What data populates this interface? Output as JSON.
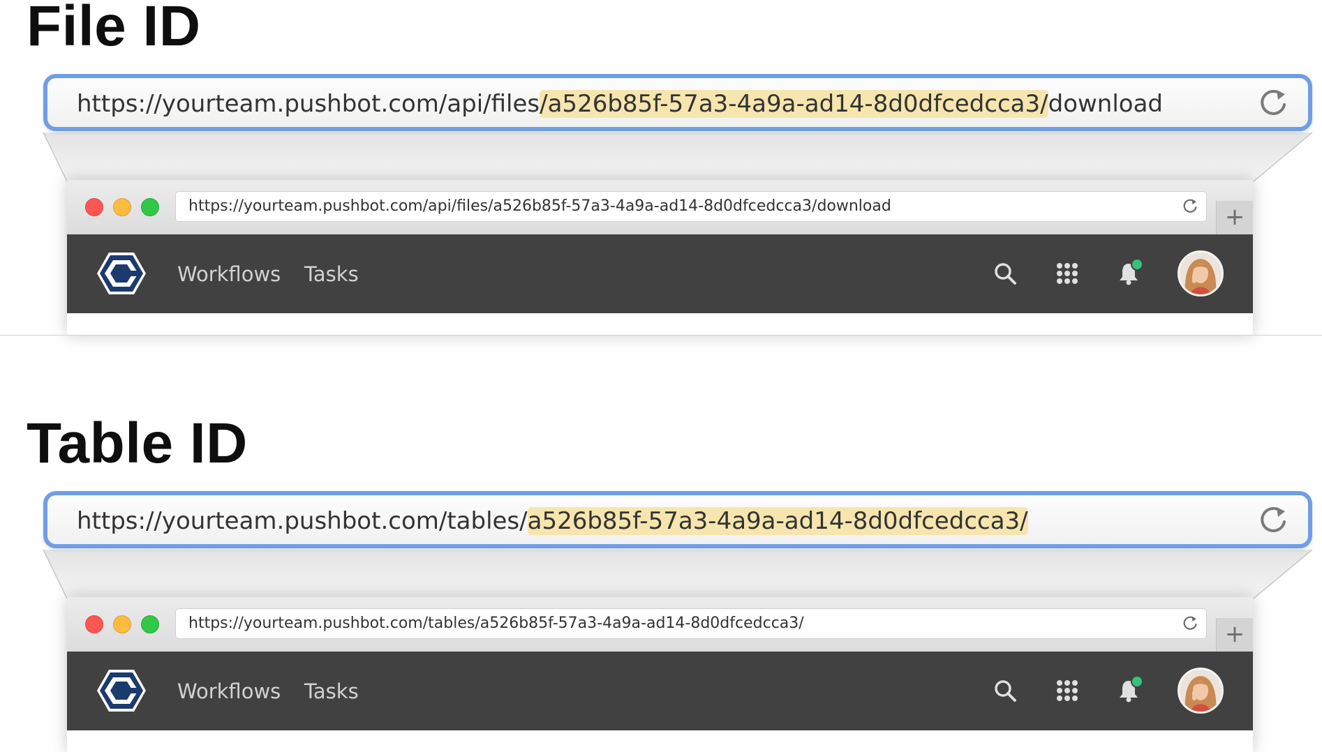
{
  "sections": [
    {
      "heading": "File ID",
      "zoomed_url": {
        "prefix": "https://yourteam.pushbot.com/api/files",
        "highlight": "/a526b85f-57a3-4a9a-ad14-8d0dfcedcca3/",
        "suffix": "download"
      },
      "browser": {
        "url": "https://yourteam.pushbot.com/api/files/a526b85f-57a3-4a9a-ad14-8d0dfcedcca3/download",
        "new_tab_label": "+",
        "nav": [
          "Workflows",
          "Tasks"
        ]
      }
    },
    {
      "heading": "Table ID",
      "zoomed_url": {
        "prefix": "https://yourteam.pushbot.com/tables/",
        "highlight": "a526b85f-57a3-4a9a-ad14-8d0dfcedcca3/",
        "suffix": ""
      },
      "browser": {
        "url": "https://yourteam.pushbot.com/tables/a526b85f-57a3-4a9a-ad14-8d0dfcedcca3/",
        "new_tab_label": "+",
        "nav": [
          "Workflows",
          "Tasks"
        ]
      }
    }
  ],
  "icons": {
    "reload": "reload-icon",
    "search": "search-icon",
    "apps": "apps-grid-icon",
    "notifications": "bell-icon",
    "logo": "pushbot-logo"
  },
  "colors": {
    "highlight": "#f6e5ae",
    "focus_ring": "#6f9ee6",
    "app_bar": "#414141",
    "logo_dark": "#1b3a6e",
    "notification_dot": "#36c27c",
    "traffic_red": "#fc5753",
    "traffic_yellow": "#fdbc40",
    "traffic_green": "#33c748"
  }
}
